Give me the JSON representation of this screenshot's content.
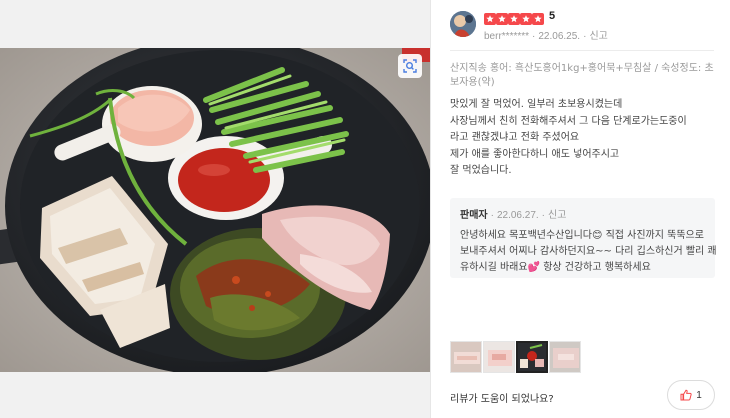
{
  "photo": {
    "alt_icon": "zoom-icon",
    "zoom_label": ""
  },
  "review": {
    "rating": "5",
    "rating_value": 5,
    "star_color": "#f5484b",
    "username": "berr*******",
    "date": "22.06.25.",
    "report": "신고",
    "option": "산지직송 홍어: 흑산도홍어1kg+홍어묵+무침살 / 숙성정도: 초보자용(약)",
    "body_lines": [
      "맛있게 잘 먹었어. 일부러 초보용시켰는데",
      "사장님께서 친히 전화해주셔서  그 다음 단계로가는도중이",
      "라고 괜찮겠냐고 전화 주셨어요",
      "제가 애를 좋아한다하니 애도 넣어주시고",
      "잘 먹었습니다."
    ]
  },
  "seller_reply": {
    "label": "판매자",
    "date": "22.06.27.",
    "report": "신고",
    "lines": [
      "안녕하세요 목포백년수산입니다😊 직접 사진까지 뚝뚝으로",
      "보내주셔서 어찌나 감사하던지요~~ 다리 깁스하신거 빨리 쾌",
      "유하시길 바래요💕 항상 건강하고 행복하세요"
    ]
  },
  "thumbnails": [
    {
      "name": "thumb-1",
      "active": false
    },
    {
      "name": "thumb-2",
      "active": false
    },
    {
      "name": "thumb-3",
      "active": true
    },
    {
      "name": "thumb-4",
      "active": false
    }
  ],
  "footer": {
    "helpful_question": "리뷰가 도움이 되었나요?",
    "like_count": "1",
    "like_icon": "thumbs-up-icon",
    "like_color": "#f5484b"
  }
}
